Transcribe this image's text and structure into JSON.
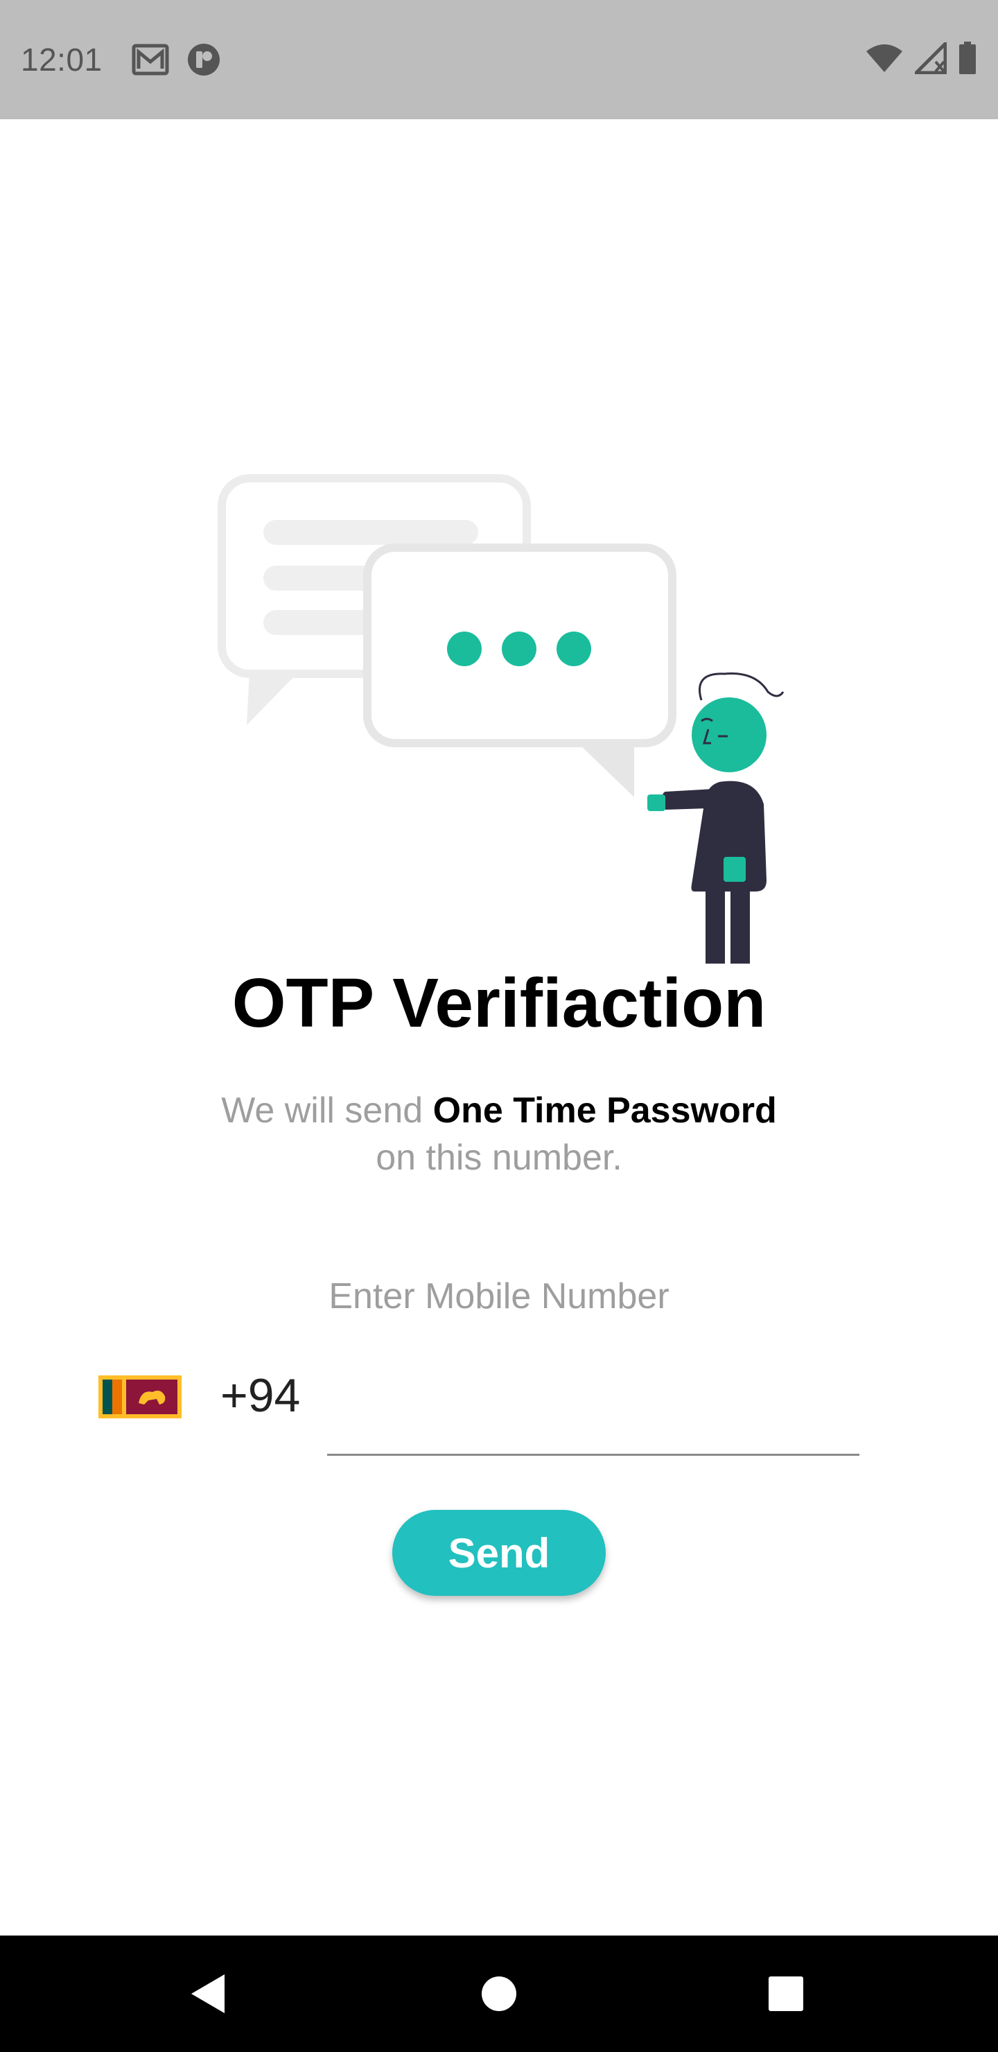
{
  "status_bar": {
    "time": "12:01",
    "icons_left": [
      "gmail-icon",
      "notification-app-icon"
    ],
    "icons_right": [
      "wifi-icon",
      "signal-icon",
      "battery-icon"
    ]
  },
  "title": "OTP Verifiaction",
  "subtitle": {
    "prefix": "We will send ",
    "emphasis": "One Time Password",
    "suffix": "on this number."
  },
  "mobile_label": "Enter Mobile Number",
  "country": {
    "flag": "sri-lanka-flag",
    "code": "+94"
  },
  "phone_input": {
    "value": "",
    "placeholder": ""
  },
  "send_button": "Send",
  "colors": {
    "accent": "#22c0bf",
    "illustration_teal": "#1abc9c",
    "figure_dark": "#2f2e41",
    "bubble_grey": "#e6e6e6",
    "status_bar": "#bdbdbd"
  },
  "nav_bar": {
    "buttons": [
      "back-icon",
      "home-icon",
      "recents-icon"
    ]
  }
}
